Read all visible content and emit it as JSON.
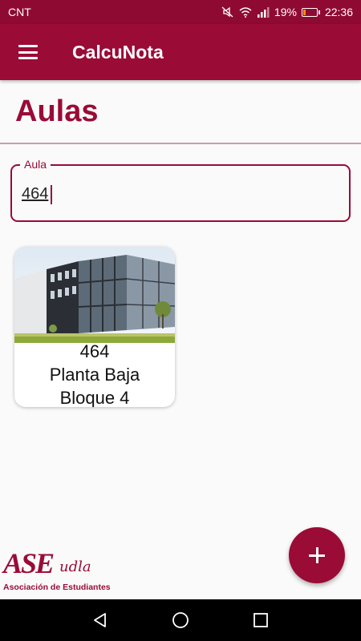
{
  "status_bar": {
    "carrier": "CNT",
    "battery_percent": "19%",
    "battery_level": 0.19,
    "time": "22:36",
    "icons": [
      "mute-icon",
      "wifi-icon",
      "signal-icon",
      "battery-icon"
    ]
  },
  "app_bar": {
    "title": "CalcuNota",
    "menu_icon": "hamburger-menu-icon"
  },
  "page": {
    "title": "Aulas"
  },
  "search_field": {
    "label": "Aula",
    "value": "464"
  },
  "cards": [
    {
      "image": "building-photo",
      "number": "464",
      "floor": "Planta Baja",
      "block": "Bloque 4"
    }
  ],
  "fab": {
    "icon": "plus-icon"
  },
  "logo": {
    "mark": "ASE",
    "script": "udla",
    "subtitle": "Asociación de Estudiantes"
  },
  "nav_bar": {
    "icons": [
      "back-icon",
      "home-icon",
      "recents-icon"
    ]
  },
  "colors": {
    "primary": "#9a0b36",
    "status_bar": "#8f0a32",
    "background": "#fafafa"
  }
}
